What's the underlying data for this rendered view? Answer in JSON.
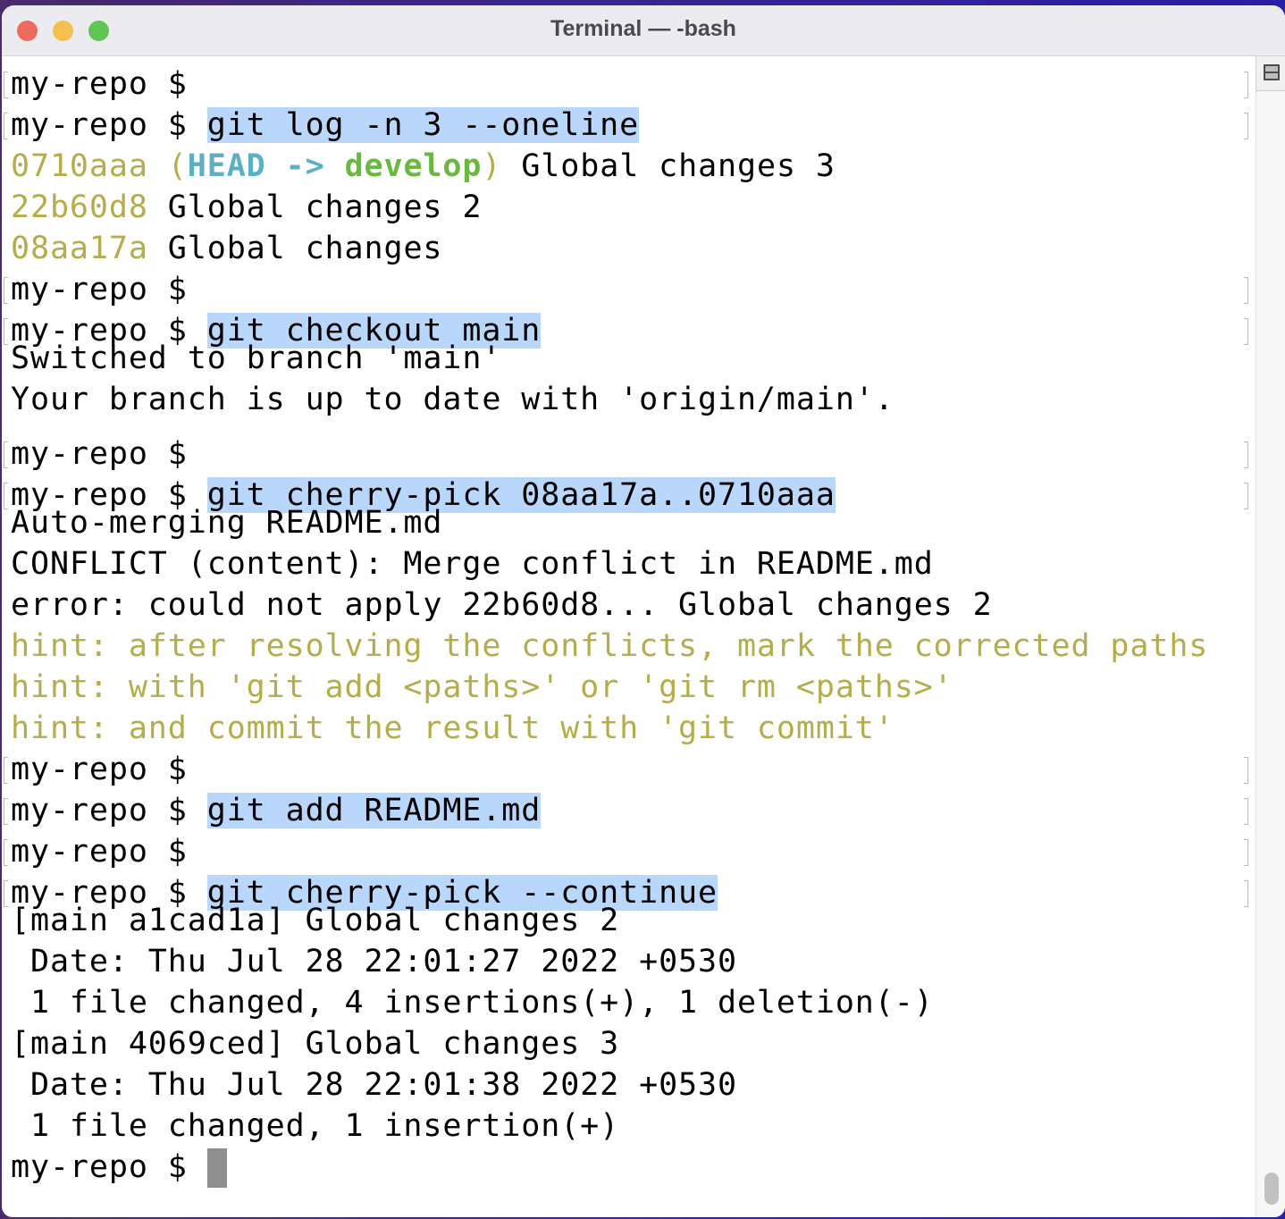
{
  "window": {
    "title": "Terminal — -bash"
  },
  "prompt": "my-repo $ ",
  "lines": [
    {
      "type": "prompt",
      "cmd": ""
    },
    {
      "type": "prompt",
      "cmd": "git log -n 3 --oneline"
    },
    {
      "type": "log",
      "hash": "0710aaa",
      "open": " (",
      "head": "HEAD ->",
      "sep": " ",
      "branch": "develop",
      "close": ")",
      "msg": " Global changes 3"
    },
    {
      "type": "log",
      "hash": "22b60d8",
      "msg": " Global changes 2"
    },
    {
      "type": "log",
      "hash": "08aa17a",
      "msg": " Global changes"
    },
    {
      "type": "prompt",
      "cmd": ""
    },
    {
      "type": "prompt",
      "cmd": "git checkout main"
    },
    {
      "type": "out",
      "text": "Switched to branch 'main'"
    },
    {
      "type": "out",
      "text": "Your branch is up to date with 'origin/main'."
    },
    {
      "type": "prompt",
      "cmd": ""
    },
    {
      "type": "prompt",
      "cmd": "git cherry-pick 08aa17a..0710aaa"
    },
    {
      "type": "out",
      "text": "Auto-merging README.md"
    },
    {
      "type": "out",
      "text": "CONFLICT (content): Merge conflict in README.md"
    },
    {
      "type": "out",
      "text": "error: could not apply 22b60d8... Global changes 2"
    },
    {
      "type": "hint",
      "text": "hint: after resolving the conflicts, mark the corrected paths"
    },
    {
      "type": "hint",
      "text": "hint: with 'git add <paths>' or 'git rm <paths>'"
    },
    {
      "type": "hint",
      "text": "hint: and commit the result with 'git commit'"
    },
    {
      "type": "prompt",
      "cmd": ""
    },
    {
      "type": "prompt",
      "cmd": "git add README.md"
    },
    {
      "type": "prompt",
      "cmd": ""
    },
    {
      "type": "prompt",
      "cmd": "git cherry-pick --continue"
    },
    {
      "type": "out",
      "text": "[main a1cad1a] Global changes 2"
    },
    {
      "type": "out",
      "text": " Date: Thu Jul 28 22:01:27 2022 +0530"
    },
    {
      "type": "out",
      "text": " 1 file changed, 4 insertions(+), 1 deletion(-)"
    },
    {
      "type": "out",
      "text": "[main 4069ced] Global changes 3"
    },
    {
      "type": "out",
      "text": " Date: Thu Jul 28 22:01:38 2022 +0530"
    },
    {
      "type": "out",
      "text": " 1 file changed, 1 insertion(+)"
    },
    {
      "type": "current",
      "cmd": ""
    }
  ],
  "scrollbar": {
    "position": 1.0
  }
}
